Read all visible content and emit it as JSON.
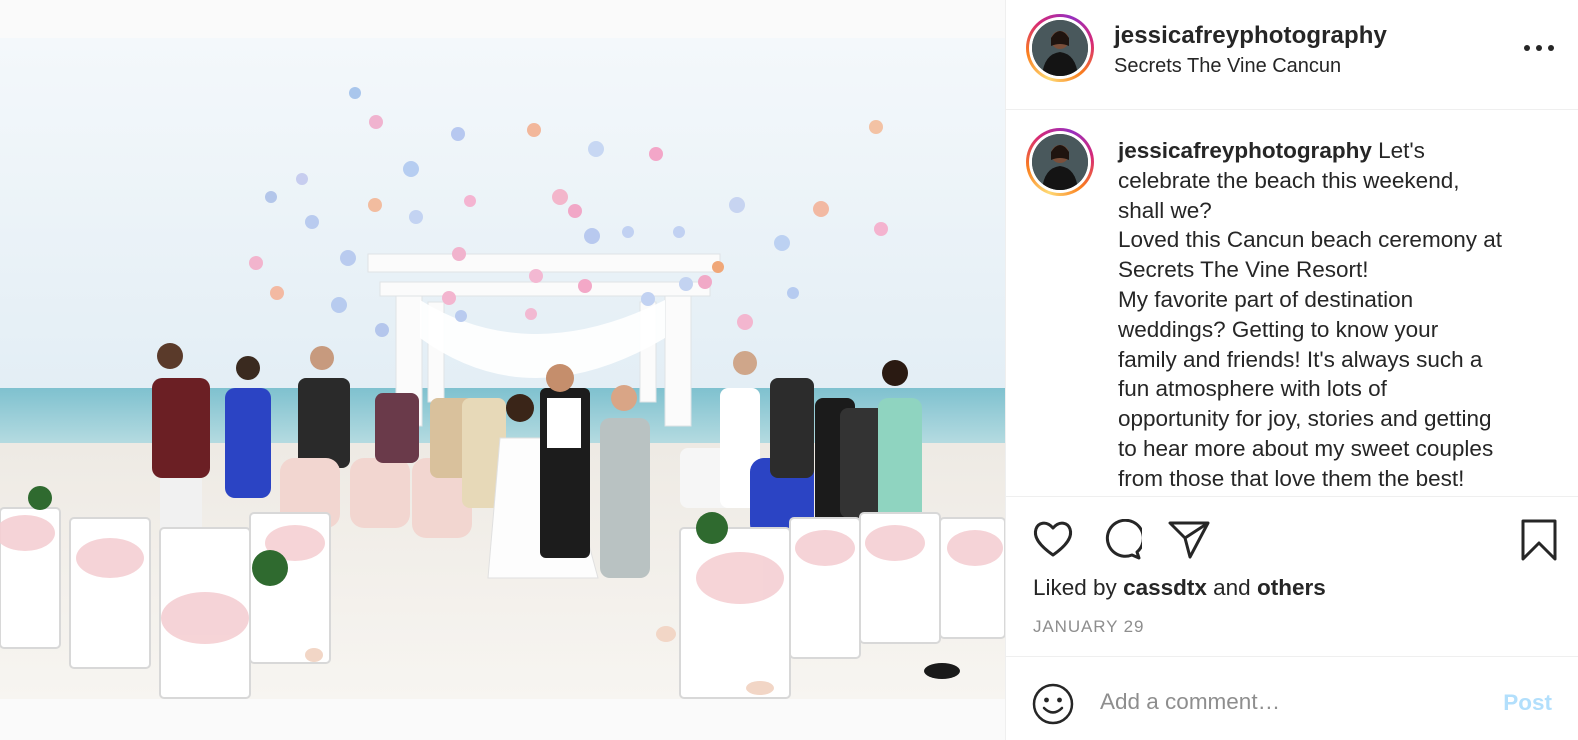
{
  "post": {
    "username": "jessicafreyphotography",
    "location": "Secrets The Vine Cancun",
    "photo_alt": "Wedding party on the beach tossing beach balls at a white gazebo ceremony site",
    "caption": {
      "username": "jessicafreyphotography",
      "lines": [
        "Let's",
        "celebrate the beach this weekend,",
        "shall we?",
        "Loved this Cancun beach ceremony at",
        "Secrets The Vine Resort!",
        "My favorite part of destination",
        "weddings? Getting to know your",
        "family and friends! It's always such a",
        "fun atmosphere with lots of",
        "opportunity for joy, stories and getting",
        "to hear more about my sweet couples",
        "from those that love them the best!"
      ]
    },
    "likes": {
      "prefix": "Liked by",
      "user": "cassdtx",
      "joiner": "and",
      "others": "others"
    },
    "date": "JANUARY 29",
    "comment": {
      "placeholder": "Add a comment…",
      "post_label": "Post"
    }
  },
  "icons": {
    "more": "more-horizontal-icon",
    "like": "heart-icon",
    "comment": "speech-bubble-icon",
    "share": "paper-plane-icon",
    "save": "bookmark-icon",
    "emoji": "smiley-icon"
  },
  "colors": {
    "text": "#262626",
    "secondary": "#8e8e8e",
    "post_disabled": "#b2dffc",
    "border": "#efefef"
  }
}
